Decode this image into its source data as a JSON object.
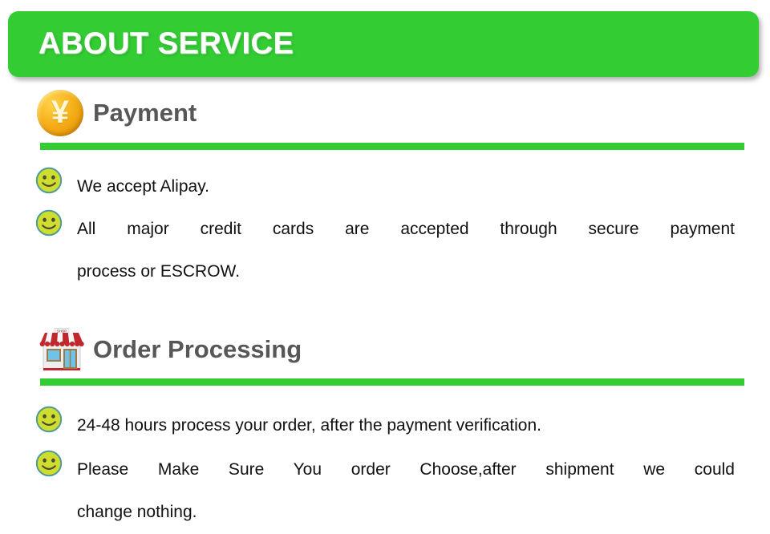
{
  "banner": {
    "title": "ABOUT SERVICE",
    "background_color": "#33cc33",
    "text_color": "#ffffff"
  },
  "theme": {
    "accent_green": "#33cc33",
    "heading_gray": "#575757",
    "body_text": "#111111",
    "page_background": "#ffffff",
    "coin_gold": "#f5ae17",
    "smiley_fill": "#cfdd2e",
    "smiley_stroke": "#4f9a9a",
    "shop_red": "#c0282d"
  },
  "sections": [
    {
      "id": "payment",
      "icon": "yen-coin-icon",
      "icon_glyph": "¥",
      "title": "Payment",
      "bullets": [
        {
          "icon": "smiley-face-icon",
          "justified": false,
          "lines": [
            "We accept Alipay."
          ]
        },
        {
          "icon": "smiley-face-icon",
          "justified": true,
          "lines": [
            "All major credit cards are accepted through secure payment",
            "process or ESCROW."
          ]
        }
      ]
    },
    {
      "id": "order-processing",
      "icon": "storefront-icon",
      "icon_glyph": "SHOP",
      "title": "Order Processing",
      "bullets": [
        {
          "icon": "smiley-face-icon",
          "justified": false,
          "lines": [
            "24-48 hours process your order, after the payment verification."
          ]
        },
        {
          "icon": "smiley-face-icon",
          "justified": true,
          "lines": [
            "Please Make Sure You order Choose,after shipment we could",
            "change nothing."
          ]
        }
      ]
    }
  ]
}
